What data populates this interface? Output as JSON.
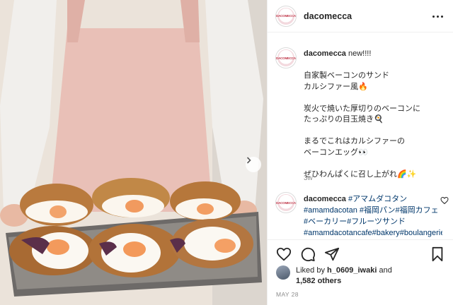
{
  "post": {
    "username": "dacomecca",
    "avatar_text": "DACOMECCA",
    "caption_username": "dacomecca",
    "caption_text": "new!!!!\n\n自家製ベーコンのサンド\nカルシファー風🔥\n\n炭火で焼いた厚切りのベーコンに\nたっぷりの目玉焼き🍳\n\nまるでこれはカルシファーの\nベーコンエッグ👀\n\nぜひわんぱくに召し上がれ🌈✨",
    "time_ago": "3w",
    "comment_username": "dacomecca",
    "comment_text": "#アマムダコタン #amamdacotan #福岡パン#福岡カフェ#ベーカリー#フルーツサンド #amamdacotancafe#bakery#boulangerie#Pan#パン#六本松パン#レ",
    "liked_by_prefix": "Liked by",
    "liked_by_user": "h_0609_iwaki",
    "liked_and": "and",
    "likes_count": "1,582 others",
    "date": "MAY 28"
  },
  "icons": {
    "more": "more-horizontal-icon",
    "like": "heart-icon",
    "comment": "comment-icon",
    "share": "share-icon",
    "save": "bookmark-icon",
    "next": "chevron-right-icon"
  }
}
